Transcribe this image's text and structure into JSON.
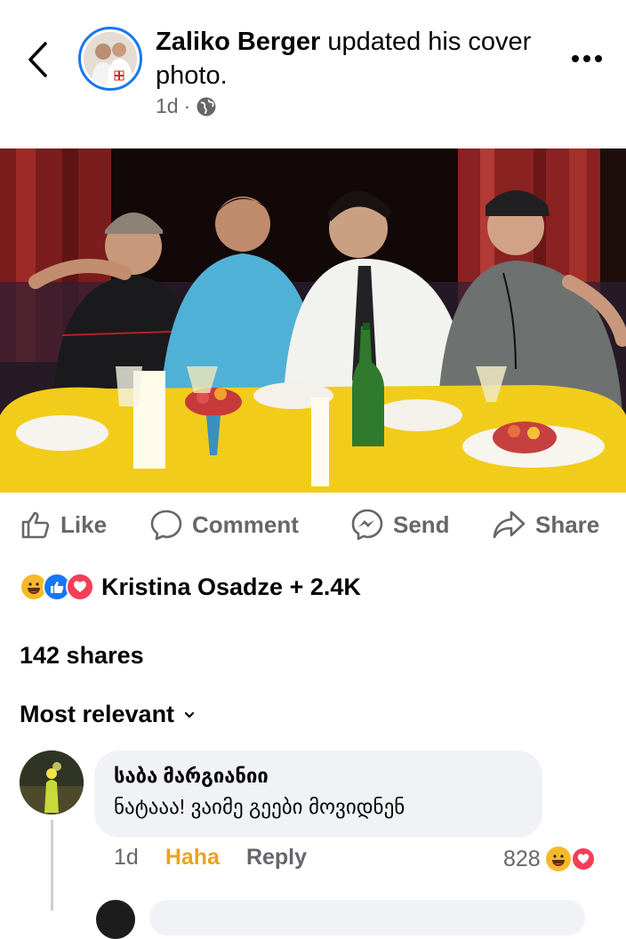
{
  "header": {
    "author": "Zaliko Berger",
    "action_text": " updated his cover photo.",
    "time": "1d",
    "separator": "·",
    "privacy_icon": "globe-icon"
  },
  "actions": {
    "like": "Like",
    "comment": "Comment",
    "send": "Send",
    "share": "Share"
  },
  "reactions": {
    "icons": [
      "haha-icon",
      "like-icon",
      "love-icon"
    ],
    "summary": "Kristina Osadze + 2.4K"
  },
  "shares": "142 shares",
  "sort": {
    "label": "Most relevant"
  },
  "comments": [
    {
      "author": "საბა მარგიანიი",
      "text": "ნატააა! ვაიმე გეები მოვიდნენ",
      "time": "1d",
      "haha_label": "Haha",
      "reply_label": "Reply",
      "reaction_count": "828"
    }
  ],
  "colors": {
    "accent": "#1877f2",
    "haha": "#e9a41e",
    "love": "#f33e58",
    "secondary_text": "#65676b",
    "bubble": "#f0f2f5"
  }
}
